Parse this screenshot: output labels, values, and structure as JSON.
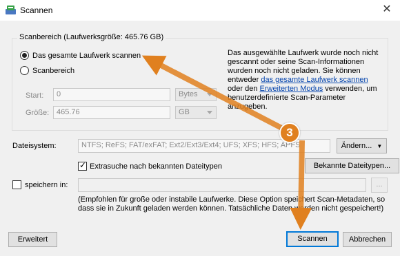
{
  "window": {
    "title": "Scannen"
  },
  "scan_area": {
    "group_label": "Scanbereich (Laufwerksgröße: 465.76 GB)",
    "radio_full_label": "Das gesamte Laufwerk scannen",
    "radio_range_label": "Scanbereich",
    "start_label": "Start:",
    "start_value": "0",
    "start_unit": "Bytes",
    "size_label": "Größe:",
    "size_value": "465.76",
    "size_unit": "GB"
  },
  "info": {
    "text1": "Das ausgewählte Laufwerk wurde noch nicht gescannt oder seine Scan-Informationen wurden noch nicht geladen. Sie können entweder",
    "link1": "das gesamte Laufwerk scannen",
    "text2": "oder den",
    "link2": "Erweiterten Modus",
    "text3": "verwenden, um benutzerdefinierte Scan-Parameter anzugeben."
  },
  "filesystem": {
    "label": "Dateisystem:",
    "value": "NTFS; ReFS; FAT/exFAT; Ext2/Ext3/Ext4; UFS; XFS; HFS; APFS",
    "change_button": "Ändern..."
  },
  "extra": {
    "checkbox_label": "Extrasuche nach bekannten Dateitypen",
    "known_types_button": "Bekannte Dateitypen..."
  },
  "save": {
    "label": "speichern in:",
    "browse_button": "...",
    "note": "(Empfohlen für große oder instabile Laufwerke. Diese Option speichert Scan-Metadaten, so dass sie in Zukunft geladen werden können. Tatsächliche Daten werden nicht gespeichert!)"
  },
  "buttons": {
    "advanced": "Erweitert",
    "scan": "Scannen",
    "cancel": "Abbrechen"
  },
  "annotation": {
    "callout_number": "3",
    "color": "#e0801f"
  }
}
